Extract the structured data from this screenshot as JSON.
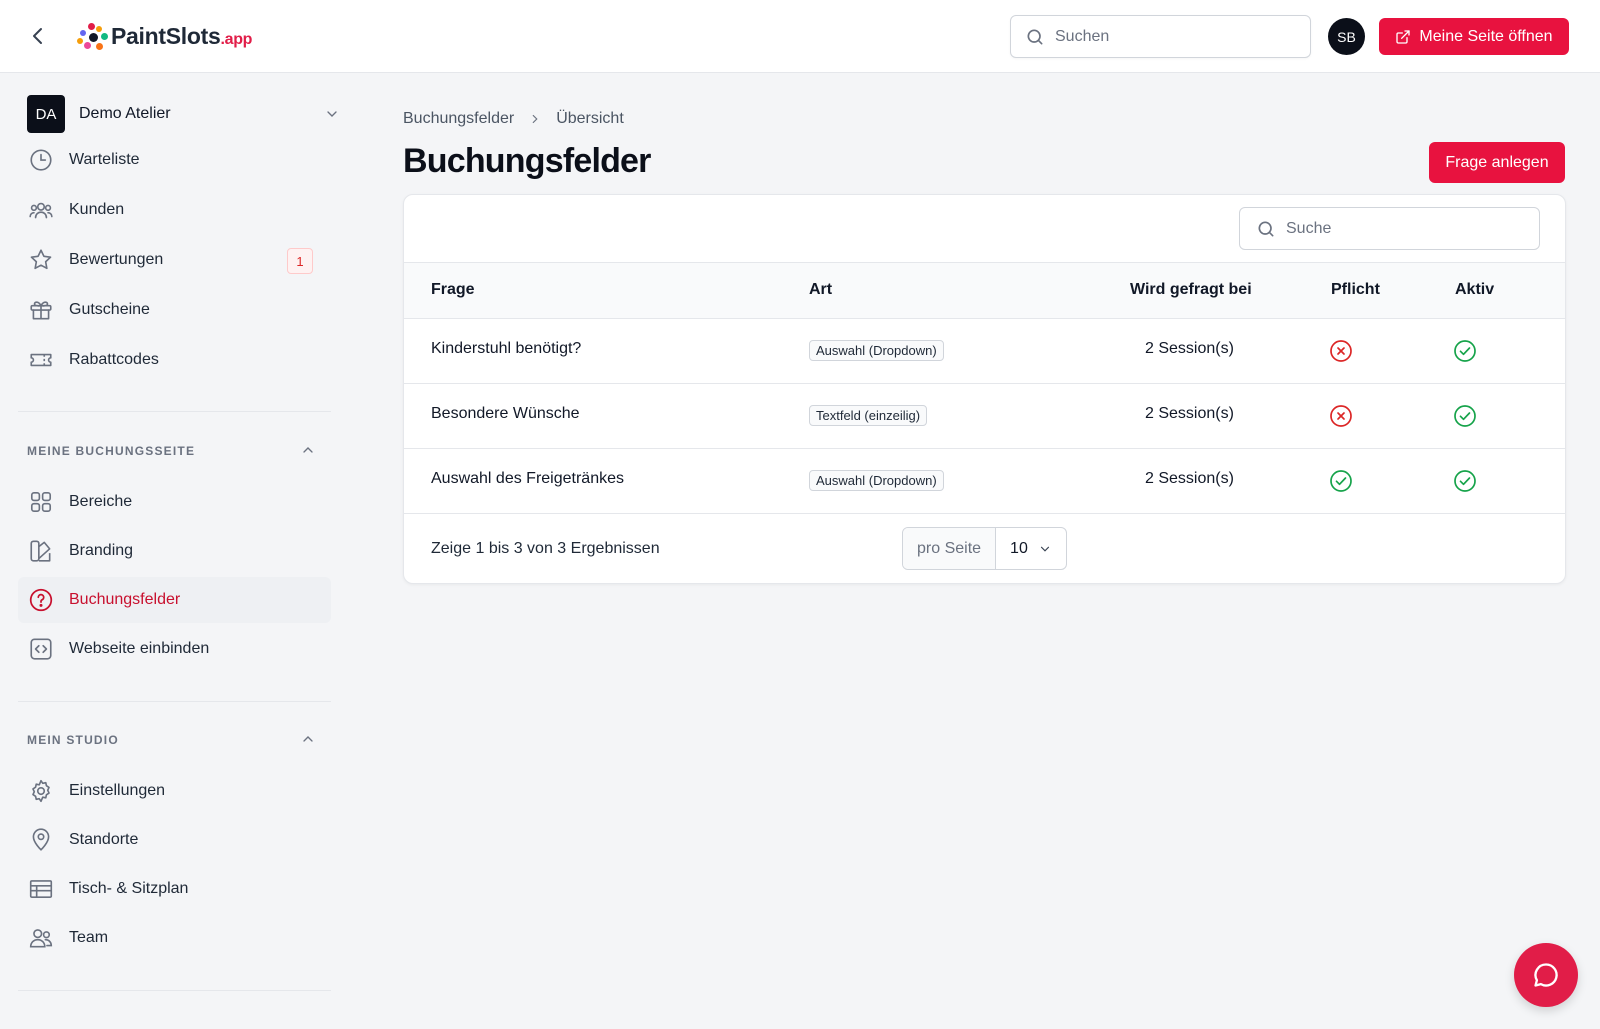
{
  "header": {
    "logo_text": "PaintSlots",
    "logo_suffix": ".app",
    "search_placeholder": "Suchen",
    "user_initials": "SB",
    "open_page_label": "Meine Seite öffnen"
  },
  "sidebar": {
    "workspace": {
      "initials": "DA",
      "name": "Demo Atelier"
    },
    "main_items": [
      {
        "label": "Warteliste",
        "icon": "clock-icon"
      },
      {
        "label": "Kunden",
        "icon": "users-group-icon"
      },
      {
        "label": "Bewertungen",
        "icon": "star-icon",
        "badge": "1"
      },
      {
        "label": "Gutscheine",
        "icon": "gift-icon"
      },
      {
        "label": "Rabattcodes",
        "icon": "ticket-icon"
      }
    ],
    "sections": [
      {
        "title": "MEINE BUCHUNGSSEITE",
        "items": [
          {
            "label": "Bereiche",
            "icon": "grid-icon"
          },
          {
            "label": "Branding",
            "icon": "swatch-icon"
          },
          {
            "label": "Buchungsfelder",
            "icon": "question-circle-icon",
            "active": true
          },
          {
            "label": "Webseite einbinden",
            "icon": "code-icon"
          }
        ]
      },
      {
        "title": "MEIN STUDIO",
        "items": [
          {
            "label": "Einstellungen",
            "icon": "gear-icon"
          },
          {
            "label": "Standorte",
            "icon": "map-pin-icon"
          },
          {
            "label": "Tisch- & Sitzplan",
            "icon": "table-icon"
          },
          {
            "label": "Team",
            "icon": "team-icon"
          }
        ]
      }
    ]
  },
  "main": {
    "breadcrumb": [
      "Buchungsfelder",
      "Übersicht"
    ],
    "title": "Buchungsfelder",
    "add_button": "Frage anlegen",
    "table": {
      "search_placeholder": "Suche",
      "columns": [
        "Frage",
        "Art",
        "Wird gefragt bei",
        "Pflicht",
        "Aktiv"
      ],
      "rows": [
        {
          "frage": "Kinderstuhl benötigt?",
          "art": "Auswahl (Dropdown)",
          "gefragt": "2 Session(s)",
          "pflicht": false,
          "aktiv": true
        },
        {
          "frage": "Besondere Wünsche",
          "art": "Textfeld (einzeilig)",
          "gefragt": "2 Session(s)",
          "pflicht": false,
          "aktiv": true
        },
        {
          "frage": "Auswahl des Freigetränkes",
          "art": "Auswahl (Dropdown)",
          "gefragt": "2 Session(s)",
          "pflicht": true,
          "aktiv": true
        }
      ],
      "summary": "Zeige 1 bis 3 von 3 Ergebnissen",
      "per_page_label": "pro Seite",
      "per_page_value": "10"
    }
  },
  "colors": {
    "accent": "#e8123f",
    "active_text": "#c8102e",
    "success": "#16a34a",
    "danger": "#dc2626"
  }
}
